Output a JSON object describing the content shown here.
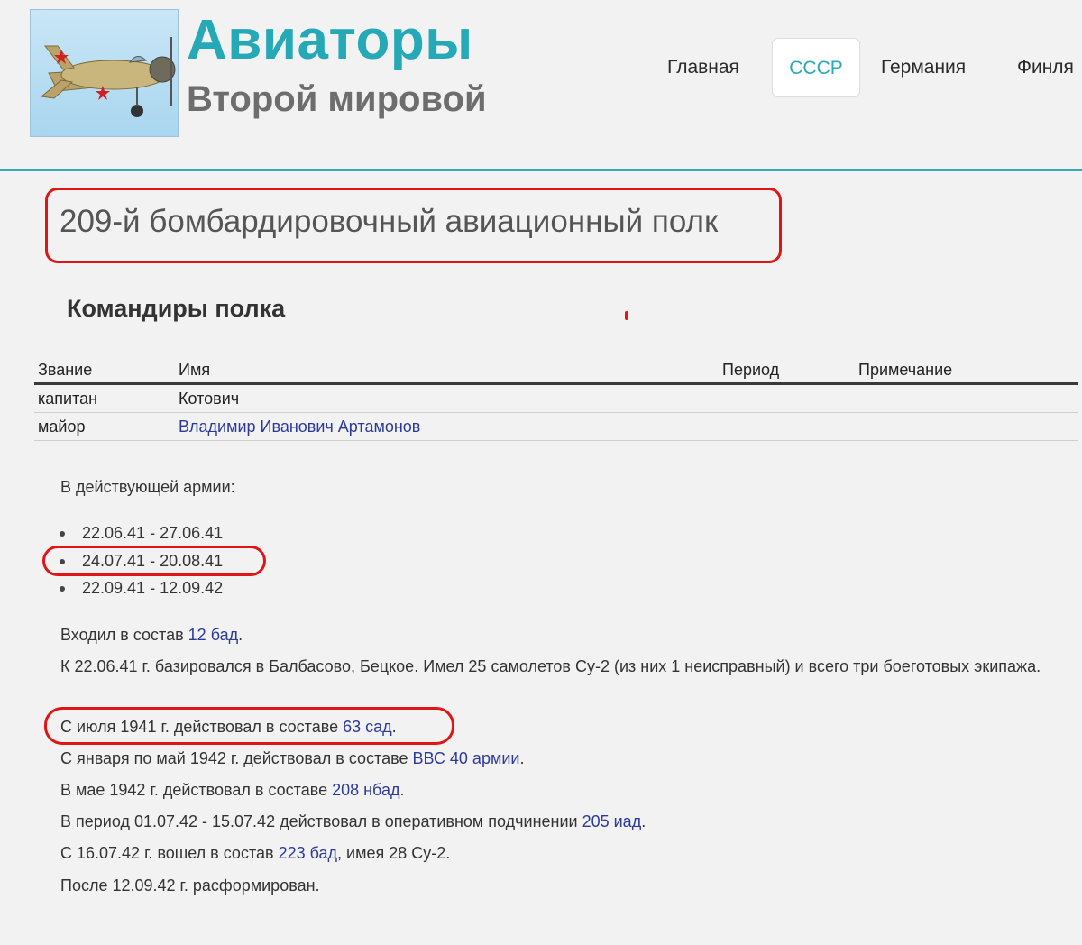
{
  "header": {
    "logo_alt": "Airplane logo",
    "site_title": "Авиаторы",
    "site_subtitle": "Второй мировой",
    "brand_color": "#25a9b6"
  },
  "nav": {
    "items": [
      {
        "label": "Главная",
        "active": false
      },
      {
        "label": "СССР",
        "active": true
      },
      {
        "label": "Германия",
        "active": false
      },
      {
        "label": "Финля",
        "active": false
      }
    ]
  },
  "page": {
    "title": "209-й бомбардировочный авиационный полк",
    "commanders_heading": "Командиры полка",
    "table": {
      "headers": [
        "Звание",
        "Имя",
        "Период",
        "Примечание"
      ],
      "rows": [
        {
          "rank": "капитан",
          "name": "Котович",
          "name_is_link": false,
          "period": "",
          "note": ""
        },
        {
          "rank": "майор",
          "name": "Владимир Иванович Артамонов",
          "name_is_link": true,
          "period": "",
          "note": ""
        }
      ]
    },
    "active_army_label": "В действующей армии:",
    "active_periods": [
      "22.06.41 - 27.06.41",
      "24.07.41 - 20.08.41",
      "22.09.41 - 12.09.42"
    ],
    "paragraphs": [
      {
        "text_before": "Входил в состав ",
        "link": "12 бад",
        "text_after": "."
      },
      {
        "text_before": "К 22.06.41 г. базировался в Балбасово, Бецкое. Имел 25 самолетов Су-2 (из них 1 неисправный) и всего три боеготовых экипажа.",
        "link": "",
        "text_after": ""
      },
      {
        "text_before": "С июля 1941 г. действовал в составе ",
        "link": "63 сад",
        "text_after": "."
      },
      {
        "text_before": "С января по май 1942 г. действовал в составе ",
        "link": "ВВС 40 армии",
        "text_after": "."
      },
      {
        "text_before": "В мае 1942 г. действовал в составе ",
        "link": "208 нбад",
        "text_after": "."
      },
      {
        "text_before": "В период 01.07.42 - 15.07.42 действовал в оперативном подчинении ",
        "link": "205 иад",
        "text_after": "."
      },
      {
        "text_before": "С 16.07.42 г. вошел в состав ",
        "link": "223 бад",
        "text_after": ", имея 28 Су-2."
      },
      {
        "text_before": "После 12.09.42 г. расформирован.",
        "link": "",
        "text_after": ""
      }
    ]
  },
  "colors": {
    "accent": "#25a9b6",
    "header_rule": "#3aa7b8",
    "link": "#2e3a9a",
    "annotation_red": "#e01515"
  }
}
